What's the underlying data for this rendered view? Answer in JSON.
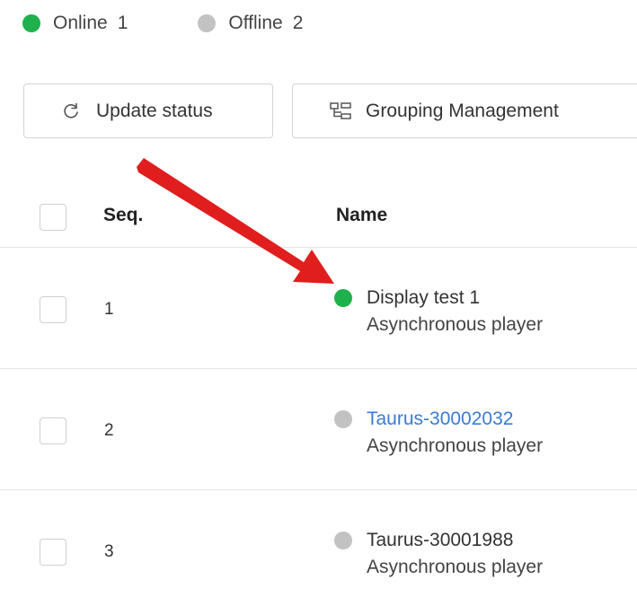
{
  "status_summary": {
    "online_label": "Online",
    "online_count": "1",
    "offline_label": "Offline",
    "offline_count": "2"
  },
  "toolbar": {
    "update_label": "Update status",
    "grouping_label": "Grouping Management"
  },
  "table": {
    "headers": {
      "seq": "Seq.",
      "name": "Name"
    },
    "rows": [
      {
        "seq": "1",
        "name": "Display test 1",
        "type": "Asynchronous player",
        "status": "online"
      },
      {
        "seq": "2",
        "name": "Taurus-30002032",
        "type": "Asynchronous player",
        "status": "offline"
      },
      {
        "seq": "3",
        "name": "Taurus-30001988",
        "type": "Asynchronous player",
        "status": "offline"
      }
    ]
  },
  "colors": {
    "online": "#1fb14b",
    "offline": "#c2c2c2",
    "link": "#3a7bd5",
    "annotation_arrow": "#e01e1e"
  },
  "icons": {
    "update": "refresh-icon",
    "grouping": "grouping-icon"
  }
}
